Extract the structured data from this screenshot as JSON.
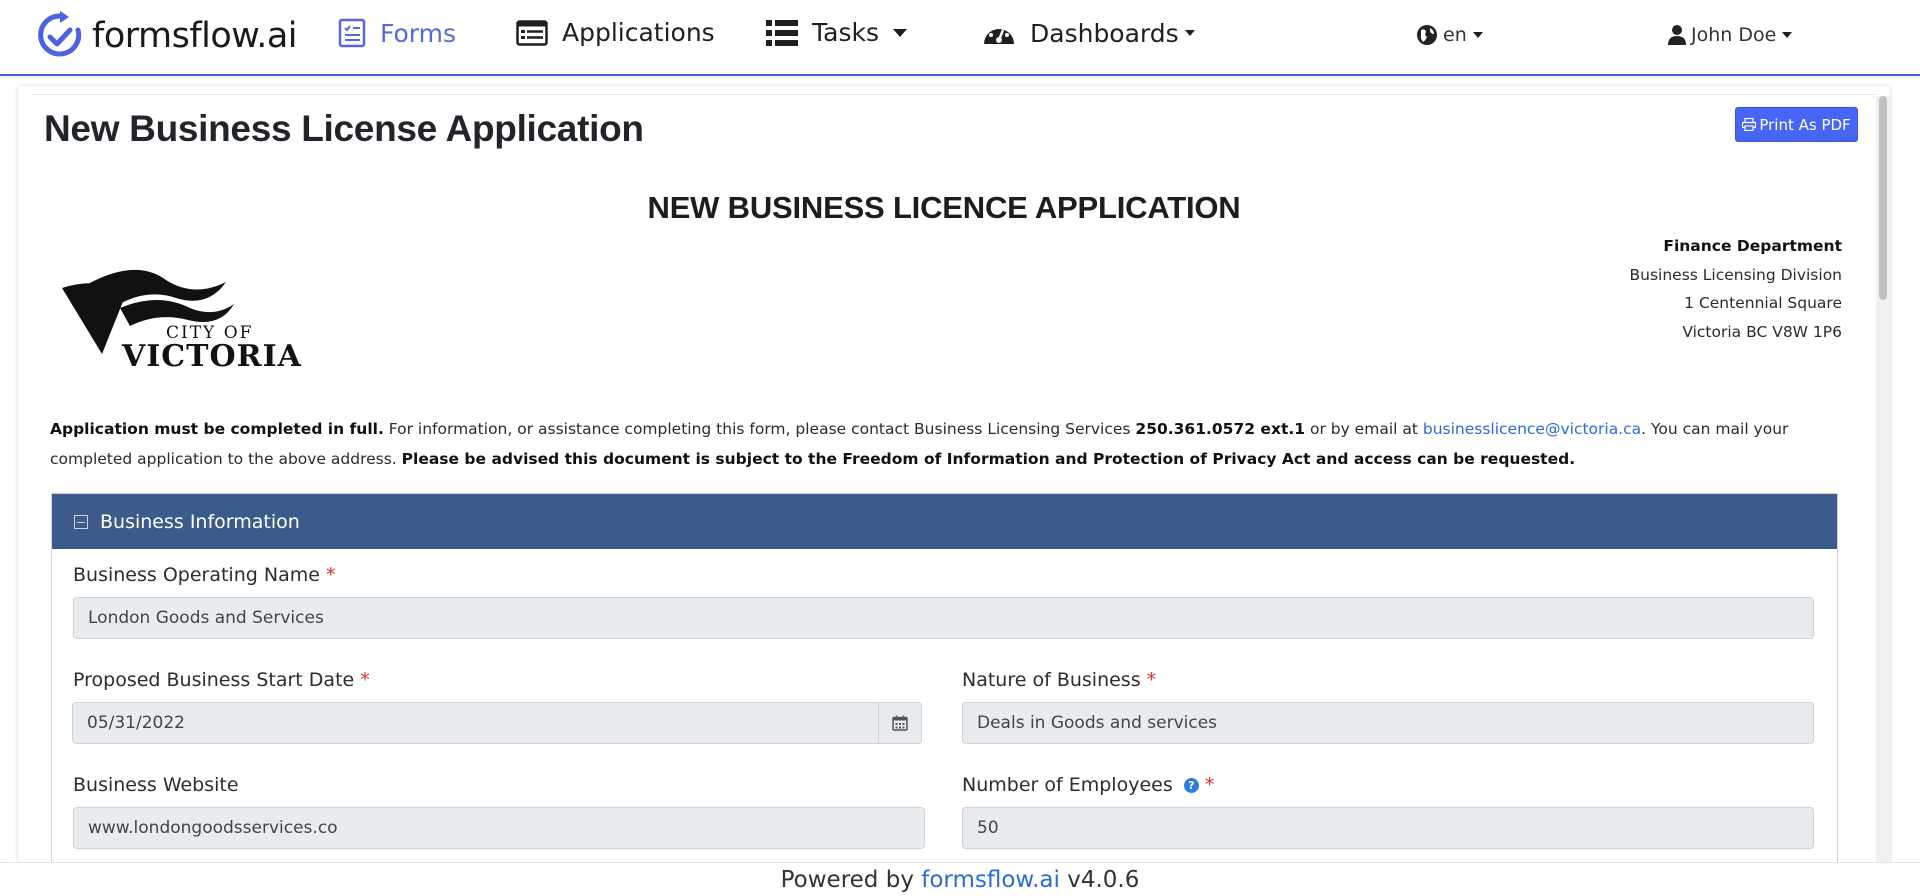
{
  "nav": {
    "brand": "formsflow.ai",
    "items": [
      {
        "label": "Forms",
        "icon": "forms-icon"
      },
      {
        "label": "Applications",
        "icon": "applications-icon"
      },
      {
        "label": "Tasks",
        "icon": "tasks-icon"
      },
      {
        "label": "Dashboards",
        "icon": "dashboards-icon"
      }
    ],
    "language": "en",
    "user": "John Doe",
    "accent_color": "#5668e0"
  },
  "page": {
    "title": "New Business License Application",
    "print_button": "Print As PDF"
  },
  "form": {
    "heading": "NEW BUSINESS LICENCE APPLICATION",
    "logo": {
      "line1": "CITY OF",
      "line2": "VICTORIA"
    },
    "address": {
      "department": "Finance Department",
      "division": "Business Licensing Division",
      "street": "1 Centennial Square",
      "city": "Victoria BC V8W 1P6"
    },
    "intro": {
      "bold1": "Application must be completed in full.",
      "text1": " For information, or assistance completing this form, please contact Business Licensing Services ",
      "phone": "250.361.0572 ext.1",
      "text2": " or by email at ",
      "email": "businesslicence@victoria.ca",
      "text3": ". You can mail your completed application to the above address. ",
      "bold2": "Please be advised this document is subject to the Freedom of Information and Protection of Privacy Act and access can be requested."
    },
    "section": {
      "title": "Business Information",
      "header_color": "#3b5b8a",
      "fields": {
        "operating_name": {
          "label": "Business Operating Name",
          "required": "*",
          "value": "London Goods and Services"
        },
        "start_date": {
          "label": "Proposed Business Start Date",
          "required": "*",
          "value": "05/31/2022"
        },
        "nature": {
          "label": "Nature of Business",
          "required": "*",
          "value": "Deals in Goods and services"
        },
        "website": {
          "label": "Business Website",
          "value": "www.londongoodsservices.co"
        },
        "employees": {
          "label": "Number of Employees",
          "required": "*",
          "help": "?",
          "value": "50"
        }
      }
    }
  },
  "footer": {
    "prefix": "Powered by ",
    "link": "formsflow.ai",
    "version": " v4.0.6"
  }
}
